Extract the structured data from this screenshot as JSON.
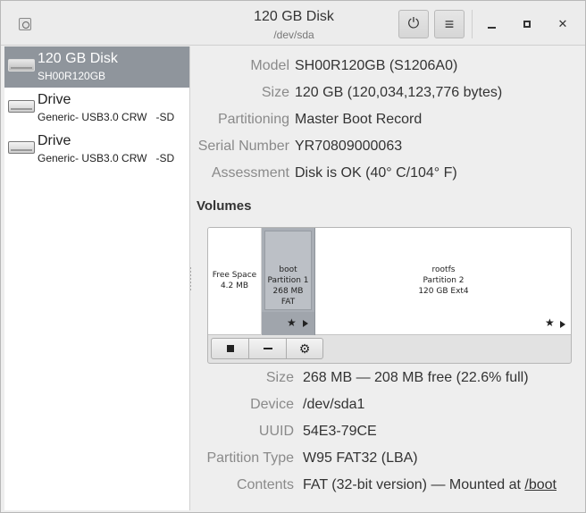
{
  "window": {
    "title": "120 GB Disk",
    "subtitle": "/dev/sda",
    "app_icon": "disks-app-icon",
    "power_button_glyph": "⏻",
    "menu_button_glyph": "≡",
    "minimize_glyph": "—",
    "maximize_glyph": "□",
    "close_glyph": "✕"
  },
  "sidebar": {
    "items": [
      {
        "name": "120 GB Disk",
        "sub": "SH00R120GB",
        "selected": true
      },
      {
        "name": "Drive",
        "sub": "Generic- USB3.0 CRW   -SD",
        "selected": false
      },
      {
        "name": "Drive",
        "sub": "Generic- USB3.0 CRW   -SD",
        "selected": false
      }
    ]
  },
  "disk_info": {
    "model_label": "Model",
    "model": "SH00R120GB (S1206A0)",
    "size_label": "Size",
    "size": "120 GB (120,034,123,776 bytes)",
    "partitioning_label": "Partitioning",
    "partitioning": "Master Boot Record",
    "serial_label": "Serial Number",
    "serial": "YR70809000063",
    "assessment_label": "Assessment",
    "assessment": "Disk is OK (40° C/104° F)"
  },
  "volumes": {
    "heading": "Volumes",
    "segments": [
      {
        "line1": "Free Space",
        "line2": "4.2 MB"
      },
      {
        "line1": "boot",
        "line2": "Partition 1",
        "line3": "268 MB FAT"
      },
      {
        "line1": "rootfs",
        "line2": "Partition 2",
        "line3": "120 GB Ext4"
      }
    ],
    "toolbar": {
      "stop_icon": "stop-icon",
      "remove_icon": "minus-icon",
      "settings_icon": "gears-icon",
      "settings_glyph": "⚙"
    }
  },
  "partition_info": {
    "size_label": "Size",
    "size": "268 MB — 208 MB free (22.6% full)",
    "device_label": "Device",
    "device": "/dev/sda1",
    "uuid_label": "UUID",
    "uuid": "54E3-79CE",
    "type_label": "Partition Type",
    "type": "W95 FAT32 (LBA)",
    "contents_label": "Contents",
    "contents": "FAT (32-bit version) — Mounted at ",
    "mount_link": "/boot"
  }
}
